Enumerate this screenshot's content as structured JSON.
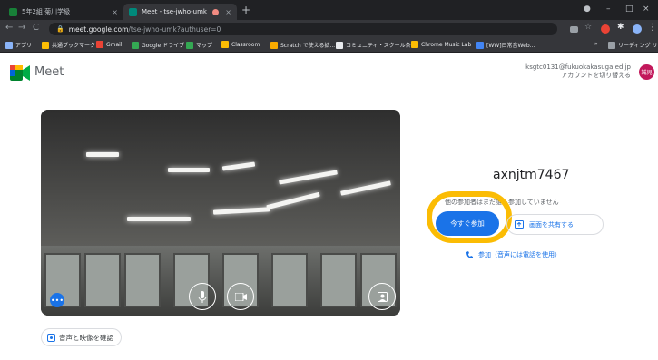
{
  "browser": {
    "tabs": [
      {
        "title": "5年2組 菊川学級",
        "close": "×"
      },
      {
        "title": "Meet - tse-jwho-umk",
        "close": "×"
      }
    ],
    "new_tab": "+",
    "window_controls": {
      "minimize": "–",
      "maximize": "□",
      "close": "×"
    },
    "url_host": "meet.google.com",
    "url_path": "/tse-jwho-umk?authuser=0",
    "bookmarks": [
      "アプリ",
      "共通ブックマーク",
      "Gmail",
      "Google ドライブ",
      "マップ",
      "Classroom",
      "Scratch で使える拡...",
      "コミュニティ・スクール条...",
      "Chrome Music Lab",
      "[WW]日常音Web...",
      "»",
      "リーディング リスト"
    ]
  },
  "header": {
    "brand": "Meet",
    "account_email": "ksgtc0131@fukuokakasuga.ed.jp",
    "switch_account": "アカウントを切り替える",
    "avatar_text": "誠児"
  },
  "preview": {
    "more_glyph": "⋮",
    "bubble_glyph": "•••"
  },
  "check_av_label": "音声と映像を確認",
  "join_panel": {
    "meeting_code": "axnjtm7467",
    "no_one_text": "他の参加者はまだ誰も参加していません",
    "join_now": "今すぐ参加",
    "present": "画面を共有する",
    "phone_join": "参加（音声には電話を使用）"
  },
  "colors": {
    "accent": "#1a73e8",
    "highlight_ring": "#fbbc04",
    "avatar": "#c2185b"
  },
  "icons": [
    "meet-logo-icon",
    "mic-icon",
    "camera-icon",
    "effects-icon",
    "present-icon",
    "phone-icon",
    "check-av-icon"
  ]
}
